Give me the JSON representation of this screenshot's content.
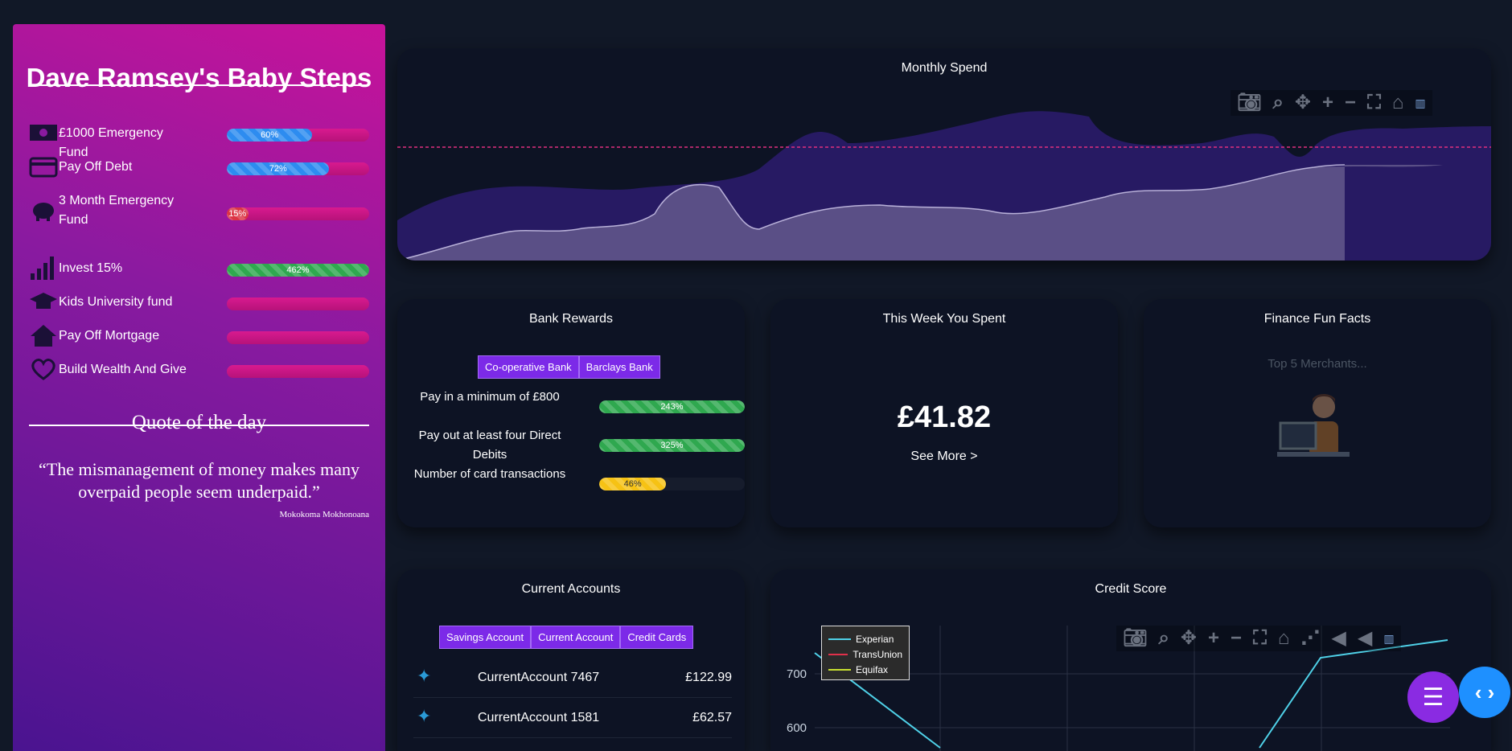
{
  "sidebar": {
    "title": "Dave Ramsey's Baby Steps",
    "steps": [
      {
        "label": "£1000 Emergency Fund",
        "icon": "money-icon",
        "progress_label": "60%",
        "progress": 60,
        "color": "blue"
      },
      {
        "label": "Pay Off Debt",
        "icon": "credit-card-icon",
        "progress_label": "72%",
        "progress": 72,
        "color": "blue"
      },
      {
        "label": "3 Month Emergency Fund",
        "icon": "piggy-bank-icon",
        "progress_label": "15%",
        "progress": 15,
        "color": "red"
      },
      {
        "label": "Invest 15%",
        "icon": "bar-chart-icon",
        "progress_label": "462%",
        "progress": 100,
        "color": "green"
      },
      {
        "label": "Kids University fund",
        "icon": "graduation-cap-icon",
        "progress_label": "",
        "progress": 0,
        "color": "blue"
      },
      {
        "label": "Pay Off Mortgage",
        "icon": "house-icon",
        "progress_label": "",
        "progress": 0,
        "color": "blue"
      },
      {
        "label": "Build Wealth And Give",
        "icon": "heart-icon",
        "progress_label": "",
        "progress": 0,
        "color": "blue"
      }
    ],
    "quote_heading": "Quote of the day",
    "quote": "“The mismanagement of money makes many overpaid people seem underpaid.”",
    "quote_author": "Mokokoma Mokhonoana"
  },
  "monthly_spend": {
    "title": "Monthly Spend",
    "modebar": [
      "camera-icon",
      "zoom-icon",
      "pan-icon",
      "zoom-in-icon",
      "zoom-out-icon",
      "autoscale-icon",
      "home-icon",
      "plotly-logo-icon"
    ],
    "colors": {
      "upper": "#2a1a6b",
      "lower": "#5a4f86",
      "threshold": "#e0307e"
    }
  },
  "bank_rewards": {
    "title": "Bank Rewards",
    "tabs": [
      "Co-operative Bank",
      "Barclays Bank"
    ],
    "rows": [
      {
        "label": "Pay in a minimum of £800",
        "progress_label": "243%",
        "progress": 100,
        "color": "green"
      },
      {
        "label": "Pay out at least four Direct Debits",
        "progress_label": "325%",
        "progress": 100,
        "color": "green"
      },
      {
        "label": "Number of card transactions",
        "progress_label": "46%",
        "progress": 46,
        "color": "yellow"
      }
    ]
  },
  "week_spent": {
    "title": "This Week You Spent",
    "amount": "£41.82",
    "link": "See More >"
  },
  "fun_facts": {
    "title": "Finance Fun Facts",
    "subtitle": "Top 5 Merchants..."
  },
  "current_accounts": {
    "title": "Current Accounts",
    "tabs": [
      "Savings Account",
      "Current Account",
      "Credit Cards"
    ],
    "accounts": [
      {
        "name": "CurrentAccount 7467",
        "balance": "£122.99"
      },
      {
        "name": "CurrentAccount 1581",
        "balance": "£62.57"
      }
    ]
  },
  "credit_score": {
    "title": "Credit Score",
    "legend": [
      {
        "name": "Experian",
        "color": "#4fd1e8"
      },
      {
        "name": "TransUnion",
        "color": "#e0304a"
      },
      {
        "name": "Equifax",
        "color": "#c8e030"
      }
    ]
  },
  "chart_data": {
    "type": "line",
    "title": "Credit Score",
    "y_ticks": [
      "700",
      "600"
    ],
    "series": [
      {
        "name": "Experian",
        "values": []
      },
      {
        "name": "TransUnion",
        "values": []
      },
      {
        "name": "Equifax",
        "values": []
      }
    ]
  }
}
